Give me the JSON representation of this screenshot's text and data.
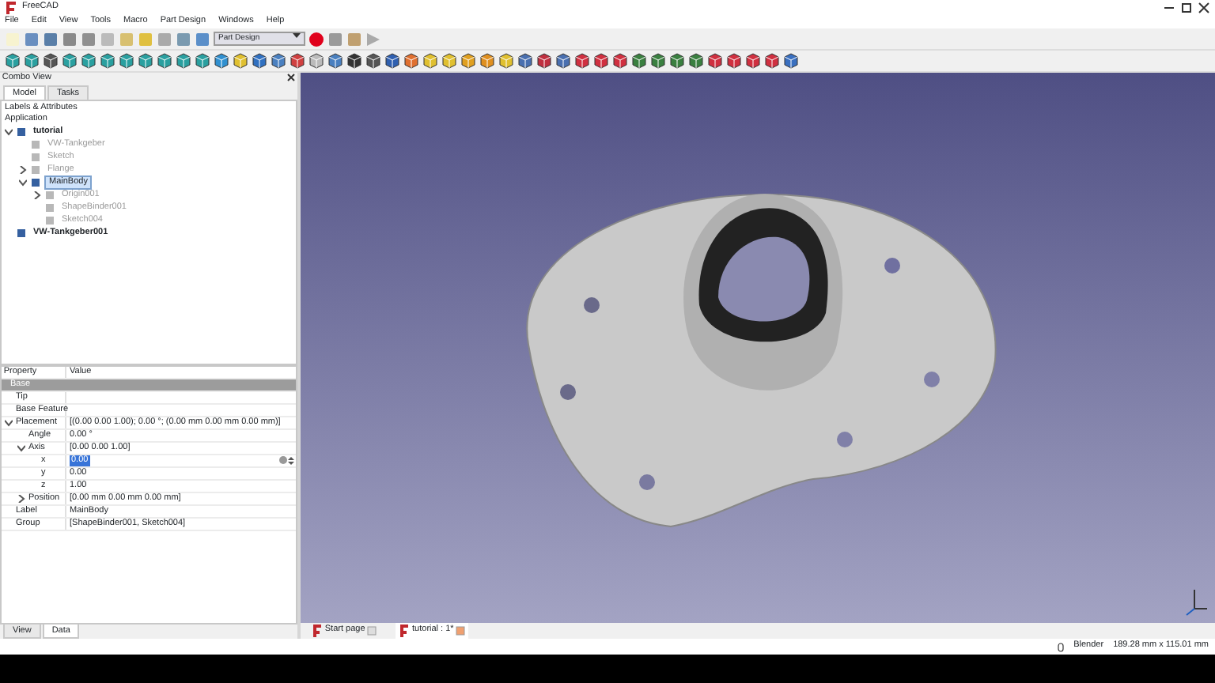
{
  "window": {
    "title": "FreeCAD"
  },
  "menu": [
    "File",
    "Edit",
    "View",
    "Tools",
    "Macro",
    "Part Design",
    "Windows",
    "Help"
  ],
  "toolbar": {
    "workbench": "Part Design"
  },
  "combo_view": {
    "title": "Combo View",
    "tabs": [
      {
        "label": "Model",
        "selected": true
      },
      {
        "label": "Tasks",
        "selected": false
      }
    ],
    "tree": {
      "header": "Labels & Attributes",
      "root": "Application",
      "items": [
        {
          "label": "tutorial",
          "visible": true,
          "bold": true,
          "selected": false,
          "expanded": true,
          "children": [
            {
              "label": "VW-Tankgeber",
              "visible": false,
              "bold": false,
              "selected": false
            },
            {
              "label": "Sketch",
              "visible": false,
              "bold": false,
              "selected": false
            },
            {
              "label": "Flange",
              "visible": false,
              "bold": false,
              "selected": false,
              "expanded": false
            },
            {
              "label": "MainBody",
              "visible": true,
              "bold": false,
              "selected": true,
              "expanded": true,
              "children": [
                {
                  "label": "Origin001",
                  "visible": false,
                  "bold": false,
                  "selected": false,
                  "expanded": false
                },
                {
                  "label": "ShapeBinder001",
                  "visible": false,
                  "bold": false,
                  "selected": false
                },
                {
                  "label": "Sketch004",
                  "visible": false,
                  "bold": false,
                  "selected": false
                }
              ]
            }
          ]
        },
        {
          "label": "VW-Tankgeber001",
          "visible": true,
          "bold": true,
          "selected": false
        }
      ]
    },
    "properties": {
      "columns": [
        "Property",
        "Value"
      ],
      "rows": [
        {
          "kind": "group",
          "name": "Base"
        },
        {
          "kind": "prop",
          "name": "Tip",
          "value": ""
        },
        {
          "kind": "prop",
          "name": "Base Feature",
          "value": ""
        },
        {
          "kind": "prop",
          "name": "Placement",
          "value": "[(0.00 0.00 1.00); 0.00 °; (0.00 mm  0.00 mm  0.00 mm)]",
          "expanded": true,
          "children": [
            {
              "kind": "prop",
              "name": "Angle",
              "value": "0.00 °"
            },
            {
              "kind": "prop",
              "name": "Axis",
              "value": "[0.00 0.00 1.00]",
              "expanded": true,
              "children": [
                {
                  "kind": "edit",
                  "name": "x",
                  "value": "0.00"
                },
                {
                  "kind": "prop",
                  "name": "y",
                  "value": "0.00"
                },
                {
                  "kind": "prop",
                  "name": "z",
                  "value": "1.00"
                }
              ]
            },
            {
              "kind": "prop",
              "name": "Position",
              "value": "[0.00 mm  0.00 mm  0.00 mm]",
              "expanded": false
            }
          ]
        },
        {
          "kind": "prop",
          "name": "Label",
          "value": "MainBody"
        },
        {
          "kind": "prop",
          "name": "Group",
          "value": "[ShapeBinder001, Sketch004]"
        }
      ]
    },
    "bottom_tabs": [
      {
        "label": "View",
        "selected": false
      },
      {
        "label": "Data",
        "selected": true
      }
    ]
  },
  "doc_tabs": [
    {
      "label": "Start page",
      "selected": false
    },
    {
      "label": "tutorial : 1*",
      "selected": true
    }
  ],
  "status_bar": {
    "navigation": "Blender",
    "dimensions": "189.28 mm x 115.01 mm"
  }
}
